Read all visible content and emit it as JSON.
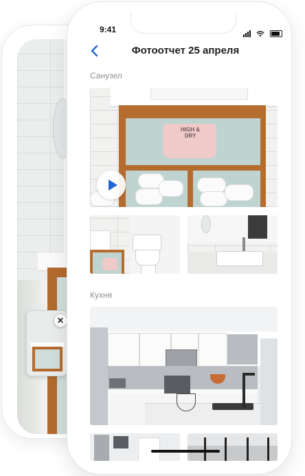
{
  "status_bar": {
    "time": "9:41"
  },
  "header": {
    "title": "Фотоотчет 25 апреля",
    "back_icon": "chevron-left-icon"
  },
  "sections": [
    {
      "label": "Санузел"
    },
    {
      "label": "Кухня"
    }
  ],
  "bathroom_bag_text": "HIGH & DRY",
  "pip": {
    "close_glyph": "✕"
  },
  "colors": {
    "accent": "#1f64d6",
    "section_label": "#8e8e93",
    "cabinet_wood": "#b56c2f"
  }
}
